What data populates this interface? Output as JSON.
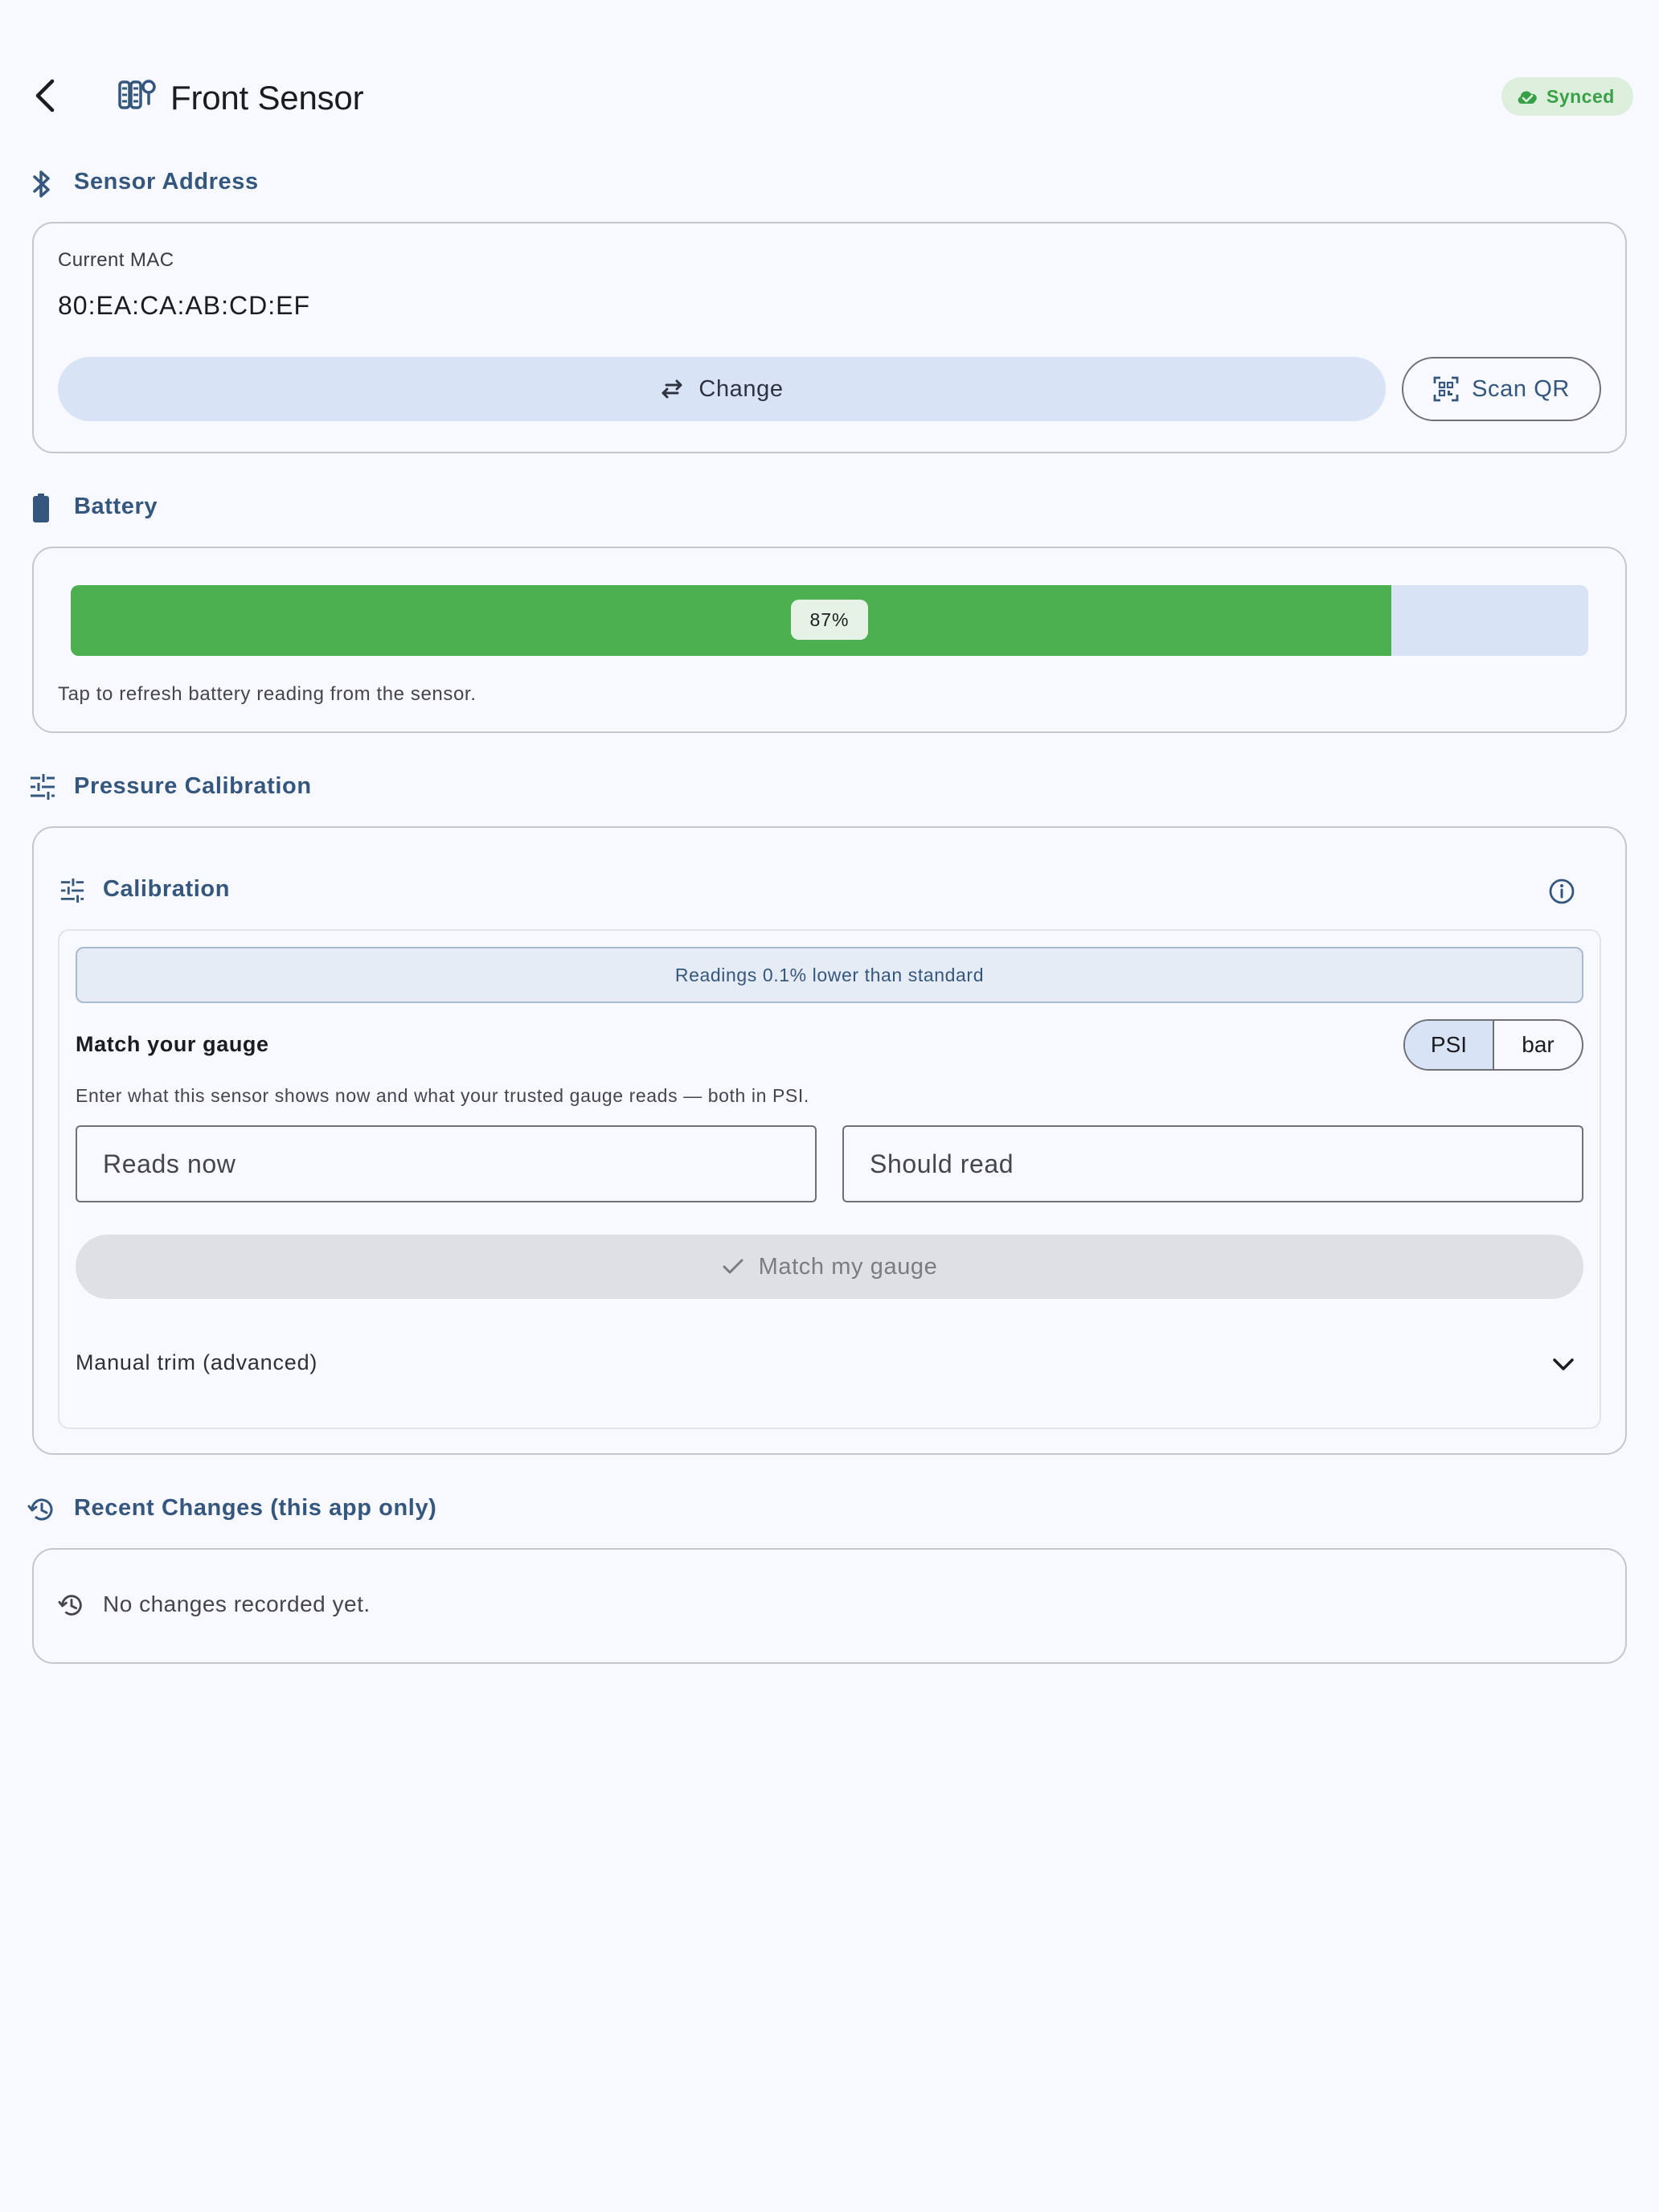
{
  "header": {
    "title": "Front Sensor",
    "status_badge": "Synced",
    "status_color": "#3aa048",
    "back_icon": "arrow-back-icon",
    "sensor_icon": "tire-sensor-icon"
  },
  "sensor_address": {
    "section_title": "Sensor Address",
    "section_icon": "bluetooth-icon",
    "mac_label": "Current MAC",
    "mac_value": "80:EA:CA:AB:CD:EF",
    "change_label": "Change",
    "scan_label": "Scan QR"
  },
  "battery": {
    "section_title": "Battery",
    "section_icon": "battery-icon",
    "level_percent": 87,
    "level_label": "87%",
    "fill_color": "#4caf50",
    "hint": "Tap to refresh battery reading from the sensor."
  },
  "pressure_calibration": {
    "section_title": "Pressure Calibration",
    "section_icon": "tune-icon",
    "card_title": "Calibration",
    "info_icon": "info-icon",
    "banner": "Readings 0.1% lower than standard",
    "match_title": "Match your gauge",
    "units": {
      "psi": "PSI",
      "bar": "bar",
      "selected": "PSI"
    },
    "description": "Enter what this sensor shows now and what your trusted gauge reads — both in PSI.",
    "reads_now_placeholder": "Reads now",
    "should_read_placeholder": "Should read",
    "match_button": "Match my gauge",
    "manual_trim": "Manual trim (advanced)"
  },
  "recent_changes": {
    "section_title": "Recent Changes (this app only)",
    "section_icon": "history-icon",
    "empty_text": "No changes recorded yet."
  }
}
